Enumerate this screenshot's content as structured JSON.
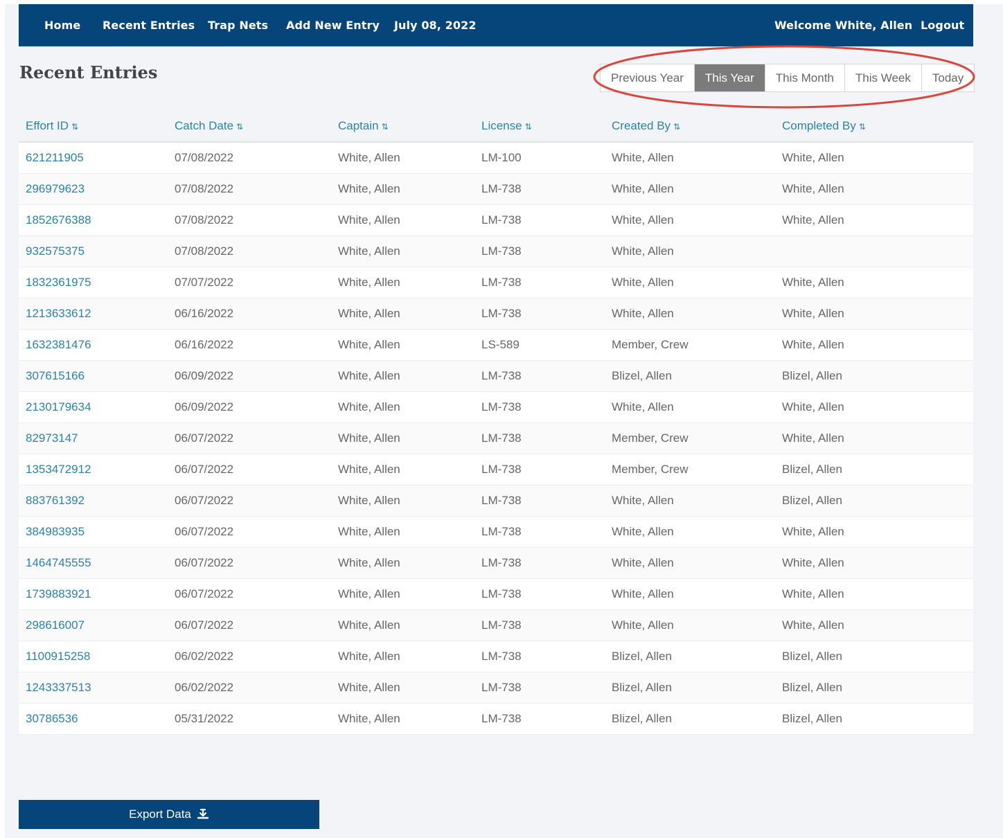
{
  "nav": {
    "home": "Home",
    "recent_entries": "Recent Entries",
    "trap_nets": "Trap Nets",
    "add_new_entry": "Add New Entry",
    "date": "July 08, 2022",
    "welcome": "Welcome White, Allen",
    "logout": "Logout"
  },
  "page": {
    "title": "Recent Entries"
  },
  "range_filter": {
    "options": [
      "Previous Year",
      "This Year",
      "This Month",
      "This Week",
      "Today"
    ],
    "selected": "This Year"
  },
  "table": {
    "columns": [
      "Effort ID",
      "Catch Date",
      "Captain",
      "License",
      "Created By",
      "Completed By"
    ],
    "rows": [
      [
        "621211905",
        "07/08/2022",
        "White, Allen",
        "LM-100",
        "White, Allen",
        "White, Allen"
      ],
      [
        "296979623",
        "07/08/2022",
        "White, Allen",
        "LM-738",
        "White, Allen",
        "White, Allen"
      ],
      [
        "1852676388",
        "07/08/2022",
        "White, Allen",
        "LM-738",
        "White, Allen",
        "White, Allen"
      ],
      [
        "932575375",
        "07/08/2022",
        "White, Allen",
        "LM-738",
        "White, Allen",
        ""
      ],
      [
        "1832361975",
        "07/07/2022",
        "White, Allen",
        "LM-738",
        "White, Allen",
        "White, Allen"
      ],
      [
        "1213633612",
        "06/16/2022",
        "White, Allen",
        "LM-738",
        "White, Allen",
        "White, Allen"
      ],
      [
        "1632381476",
        "06/16/2022",
        "White, Allen",
        "LS-589",
        "Member, Crew",
        "White, Allen"
      ],
      [
        "307615166",
        "06/09/2022",
        "White, Allen",
        "LM-738",
        "Blizel, Allen",
        "Blizel, Allen"
      ],
      [
        "2130179634",
        "06/09/2022",
        "White, Allen",
        "LM-738",
        "White, Allen",
        "White, Allen"
      ],
      [
        "82973147",
        "06/07/2022",
        "White, Allen",
        "LM-738",
        "Member, Crew",
        "White, Allen"
      ],
      [
        "1353472912",
        "06/07/2022",
        "White, Allen",
        "LM-738",
        "Member, Crew",
        "Blizel, Allen"
      ],
      [
        "883761392",
        "06/07/2022",
        "White, Allen",
        "LM-738",
        "White, Allen",
        "Blizel, Allen"
      ],
      [
        "384983935",
        "06/07/2022",
        "White, Allen",
        "LM-738",
        "White, Allen",
        "White, Allen"
      ],
      [
        "1464745555",
        "06/07/2022",
        "White, Allen",
        "LM-738",
        "White, Allen",
        "White, Allen"
      ],
      [
        "1739883921",
        "06/07/2022",
        "White, Allen",
        "LM-738",
        "White, Allen",
        "White, Allen"
      ],
      [
        "298616007",
        "06/07/2022",
        "White, Allen",
        "LM-738",
        "White, Allen",
        "White, Allen"
      ],
      [
        "1100915258",
        "06/02/2022",
        "White, Allen",
        "LM-738",
        "Blizel, Allen",
        "Blizel, Allen"
      ],
      [
        "1243337513",
        "06/02/2022",
        "White, Allen",
        "LM-738",
        "Blizel, Allen",
        "Blizel, Allen"
      ],
      [
        "30786536",
        "05/31/2022",
        "White, Allen",
        "LM-738",
        "Blizel, Allen",
        "Blizel, Allen"
      ]
    ]
  },
  "export": {
    "label": "Export Data",
    "icon": "export-icon"
  },
  "icons": {
    "sort": "sort-icon"
  },
  "colors": {
    "nav_bg": "#064579",
    "link": "#2b82a8",
    "active_range": "#7b7b7b",
    "annotation": "#d9463b"
  }
}
